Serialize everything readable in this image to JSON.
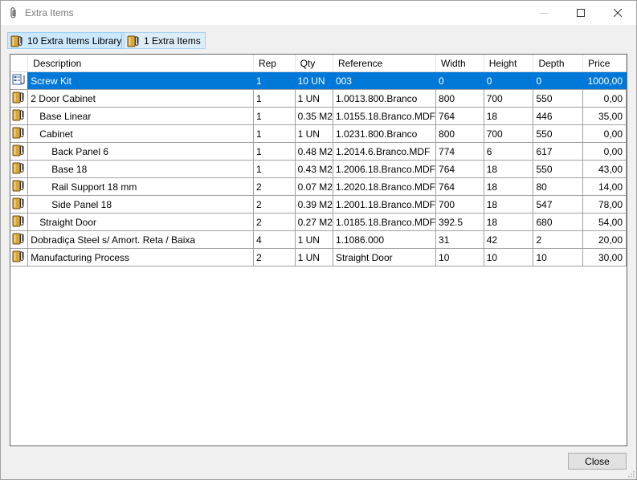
{
  "window": {
    "title": "Extra Items",
    "icon": "paperclip-icon",
    "controls": [
      "minimize-icon",
      "maximize-icon",
      "close-icon"
    ]
  },
  "toolbar": {
    "tabs": [
      {
        "label": "10 Extra Items Library",
        "icon": "library-book-icon",
        "active": true
      },
      {
        "label": "1 Extra Items",
        "icon": "library-book-icon",
        "active": false
      }
    ]
  },
  "grid": {
    "columns": [
      "",
      "Description",
      "Rep",
      "Qty",
      "Reference",
      "Width",
      "Height",
      "Depth",
      "Price"
    ],
    "rows": [
      {
        "indent": 0,
        "selected": true,
        "icon": "kit-icon",
        "description": "Screw Kit",
        "rep": "1",
        "qty": "10 UN",
        "reference": "003",
        "width": "0",
        "height": "0",
        "depth": "0",
        "price": "1000,00"
      },
      {
        "indent": 0,
        "selected": false,
        "icon": "item-icon",
        "description": "2 Door Cabinet",
        "rep": "1",
        "qty": "1 UN",
        "reference": "1.0013.800.Branco",
        "width": "800",
        "height": "700",
        "depth": "550",
        "price": "0,00"
      },
      {
        "indent": 1,
        "selected": false,
        "icon": "item-icon",
        "description": "Base Linear",
        "rep": "1",
        "qty": "0.35 M2",
        "reference": "1.0155.18.Branco.MDF",
        "width": "764",
        "height": "18",
        "depth": "446",
        "price": "35,00"
      },
      {
        "indent": 1,
        "selected": false,
        "icon": "item-icon",
        "description": "Cabinet",
        "rep": "1",
        "qty": "1 UN",
        "reference": "1.0231.800.Branco",
        "width": "800",
        "height": "700",
        "depth": "550",
        "price": "0,00"
      },
      {
        "indent": 2,
        "selected": false,
        "icon": "item-icon",
        "description": "Back Panel 6",
        "rep": "1",
        "qty": "0.48 M2",
        "reference": "1.2014.6.Branco.MDF",
        "width": "774",
        "height": "6",
        "depth": "617",
        "price": "0,00"
      },
      {
        "indent": 2,
        "selected": false,
        "icon": "item-icon",
        "description": "Base 18",
        "rep": "1",
        "qty": "0.43 M2",
        "reference": "1.2006.18.Branco.MDF",
        "width": "764",
        "height": "18",
        "depth": "550",
        "price": "43,00"
      },
      {
        "indent": 2,
        "selected": false,
        "icon": "item-icon",
        "description": "Rail Support 18 mm",
        "rep": "2",
        "qty": "0.07 M2",
        "reference": "1.2020.18.Branco.MDF",
        "width": "764",
        "height": "18",
        "depth": "80",
        "price": "14,00"
      },
      {
        "indent": 2,
        "selected": false,
        "icon": "item-icon",
        "description": "Side Panel 18",
        "rep": "2",
        "qty": "0.39 M2",
        "reference": "1.2001.18.Branco.MDF",
        "width": "700",
        "height": "18",
        "depth": "547",
        "price": "78,00"
      },
      {
        "indent": 1,
        "selected": false,
        "icon": "item-icon",
        "description": "Straight Door",
        "rep": "2",
        "qty": "0.27 M2",
        "reference": "1.0185.18.Branco.MDF",
        "width": "392.5",
        "height": "18",
        "depth": "680",
        "price": "54,00"
      },
      {
        "indent": 0,
        "selected": false,
        "icon": "item-icon",
        "description": "Dobradiça Steel s/ Amort. Reta / Baixa",
        "rep": "4",
        "qty": "1 UN",
        "reference": "1.1086.000",
        "width": "31",
        "height": "42",
        "depth": "2",
        "price": "20,00"
      },
      {
        "indent": 0,
        "selected": false,
        "icon": "item-icon",
        "description": "Manufacturing Process",
        "rep": "2",
        "qty": "1 UN",
        "reference": "Straight Door",
        "width": "10",
        "height": "10",
        "depth": "10",
        "price": "30,00"
      }
    ]
  },
  "footer": {
    "close_label": "Close"
  },
  "colors": {
    "selection": "#0078d7",
    "tab_active_bg": "#cce8ff",
    "tab_border": "#99d1ff",
    "window_bg": "#f0f0f0"
  }
}
